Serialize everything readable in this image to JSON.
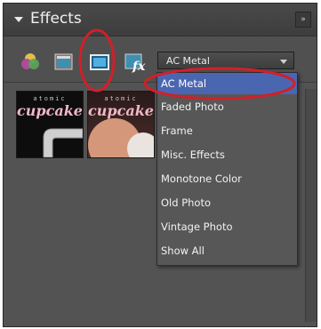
{
  "panel": {
    "title": "Effects",
    "menu_glyph": "»"
  },
  "toolbar": {
    "icons": [
      "filters-icon",
      "layer-styles-icon",
      "photo-effects-icon",
      "fx-icon"
    ],
    "dropdown_value": "AC Metal"
  },
  "dropdown_menu": {
    "items": [
      "AC Metal",
      "Faded Photo",
      "Frame",
      "Misc. Effects",
      "Monotone Color",
      "Old Photo",
      "Vintage Photo",
      "Show All"
    ],
    "selected_index": 0
  },
  "thumbnails": [
    {
      "small_text": "atomic",
      "big_text": "cupcake"
    },
    {
      "small_text": "atomic",
      "big_text": "cupcake"
    }
  ],
  "colors": {
    "annotation_red": "#d0202a",
    "selection_blue": "#4b66b1"
  }
}
